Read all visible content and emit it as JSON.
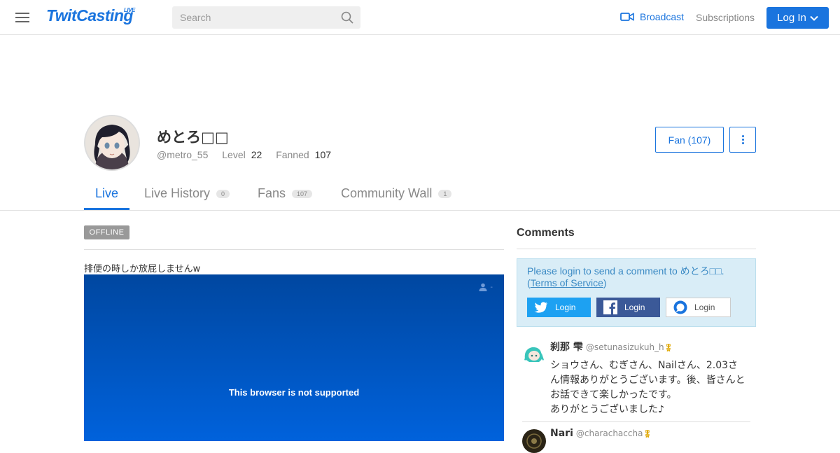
{
  "header": {
    "logo_text": "TwitCasting",
    "logo_tag": "LIVE",
    "search_placeholder": "Search",
    "broadcast_label": "Broadcast",
    "subscriptions_label": "Subscriptions",
    "login_label": "Log In",
    "accent_color": "#1a74de"
  },
  "profile": {
    "name": "めとろ□□",
    "handle": "@metro_55",
    "level_label": "Level",
    "level_value": "22",
    "fanned_label": "Fanned",
    "fanned_value": "107",
    "fan_button_label": "Fan (107)"
  },
  "tabs": [
    {
      "label": "Live",
      "badge": "",
      "active": true
    },
    {
      "label": "Live History",
      "badge": "0",
      "active": false
    },
    {
      "label": "Fans",
      "badge": "107",
      "active": false
    },
    {
      "label": "Community Wall",
      "badge": "1",
      "active": false
    }
  ],
  "live": {
    "status_badge": "OFFLINE",
    "movie_title": "排便の時しか放屁しませんw",
    "viewer_count": "-",
    "player_message": "This browser is not supported",
    "player_color": "#0055c4"
  },
  "comments": {
    "title": "Comments",
    "login_note_prefix": "Please login to send a comment to めとろ□□.(",
    "login_note_link": "Terms of Service",
    "login_note_suffix": ")",
    "login_buttons": {
      "twitter": "Login",
      "facebook": "Login",
      "twitcasting": "Login"
    },
    "items": [
      {
        "name": "刹那 雫",
        "handle": "@setunasizukuh_h",
        "text": "ショウさん、むぎさん、Nailさん、2.03さん情報ありがとうございます。後、皆さんとお話できて楽しかったです。\nありがとうございました♪"
      },
      {
        "name": "Nari",
        "handle": "@charachaccha",
        "text": ""
      }
    ]
  }
}
